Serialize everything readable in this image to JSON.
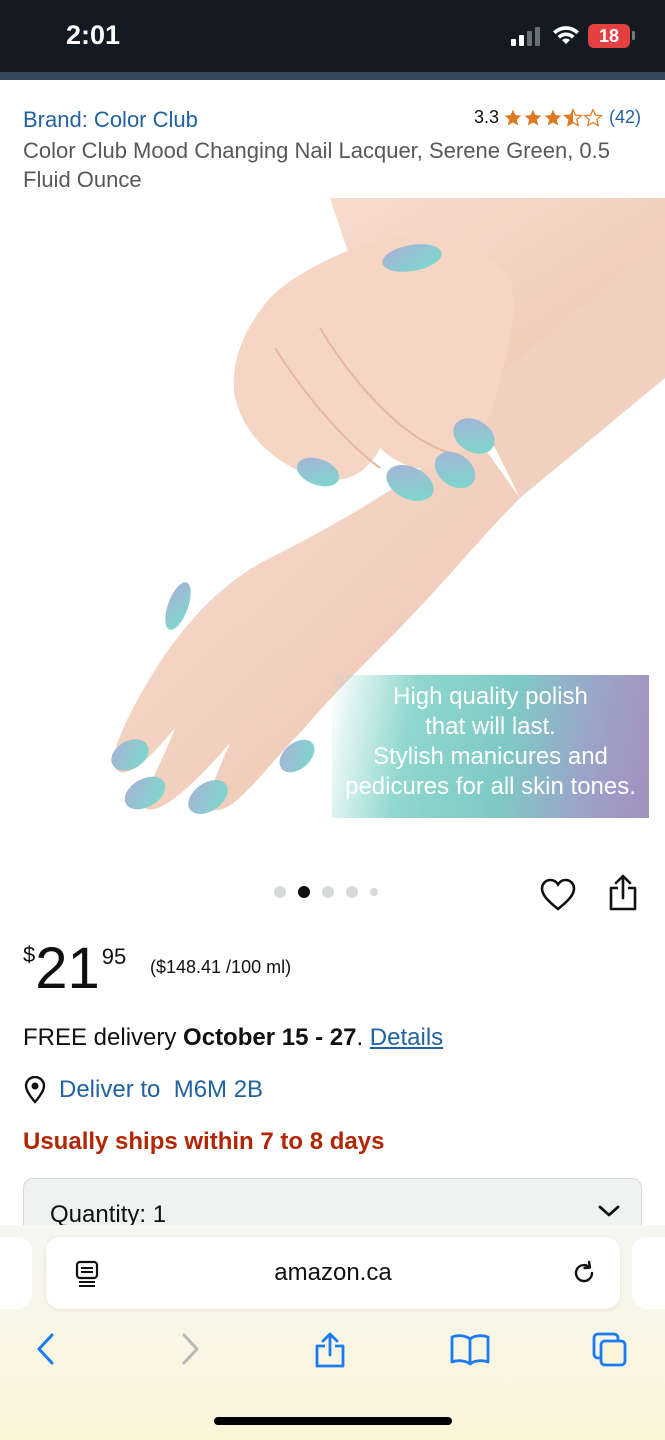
{
  "status": {
    "time": "2:01",
    "battery": "18"
  },
  "product": {
    "brand": "Brand: Color Club",
    "rating_value": "3.3",
    "rating_stars": 3.5,
    "rating_count": "(42)",
    "title": "Color Club Mood Changing Nail Lacquer, Serene Green, 0.5 Fluid Ounce",
    "image_text_line1": "High quality polish",
    "image_text_line2": "that will last.",
    "image_text_line3": "Stylish manicures and",
    "image_text_line4": "pedicures for all skin tones.",
    "image_count": 5,
    "image_index": 2
  },
  "price": {
    "symbol": "$",
    "whole": "21",
    "fraction": "95",
    "unit_price": "($148.41 /100 ml)"
  },
  "delivery": {
    "prefix": "FREE delivery ",
    "dates": "October 15 - 27",
    "period": ". ",
    "details_link": "Details",
    "deliver_to": "Deliver to  M6M 2B",
    "shipping_note": "Usually ships within 7 to 8 days"
  },
  "quantity": {
    "label": "Quantity: 1"
  },
  "browser": {
    "domain": "amazon.ca"
  },
  "colors": {
    "link": "#2162a1",
    "star": "#de7921",
    "alert": "#b12704",
    "ios_blue": "#1a7cf0"
  },
  "icons": {
    "signal": "cellular-signal-icon",
    "wifi": "wifi-icon",
    "heart": "heart-icon",
    "share": "share-icon",
    "location": "location-pin-icon",
    "chevron": "chevron-down-icon",
    "reader": "reader-mode-icon",
    "reload": "reload-icon",
    "back": "back-icon",
    "forward": "forward-icon",
    "bookmarks": "bookmarks-icon",
    "tabs": "tabs-icon"
  }
}
